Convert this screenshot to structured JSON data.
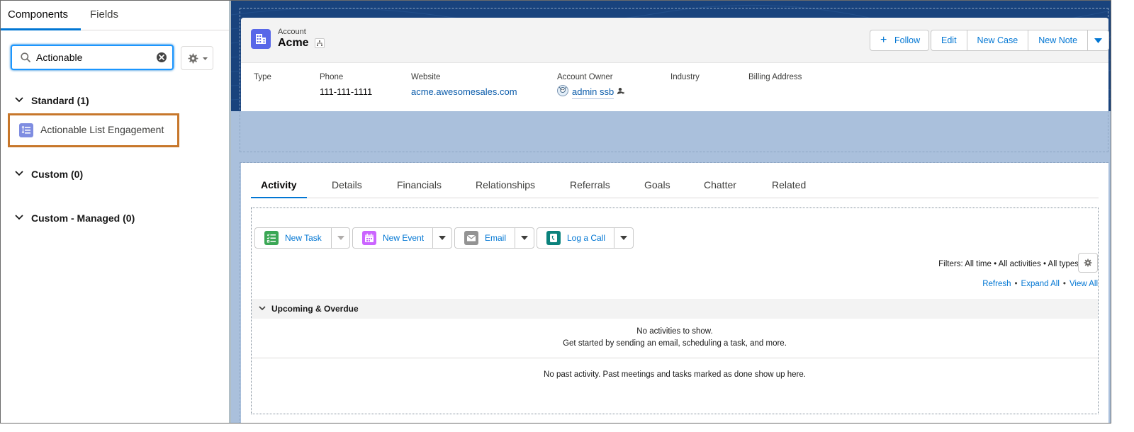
{
  "left_panel": {
    "tabs": [
      {
        "label": "Components",
        "active": true
      },
      {
        "label": "Fields",
        "active": false
      }
    ],
    "search": {
      "value": "Actionable",
      "placeholder": ""
    },
    "sections": [
      {
        "label": "Standard (1)",
        "items": [
          "Actionable List Engagement"
        ]
      },
      {
        "label": "Custom (0)",
        "items": []
      },
      {
        "label": "Custom - Managed (0)",
        "items": []
      }
    ]
  },
  "record": {
    "object_label": "Account",
    "name": "Acme",
    "buttons": {
      "follow": "Follow",
      "edit": "Edit",
      "new_case": "New Case",
      "new_note": "New Note"
    },
    "fields": [
      {
        "label": "Type",
        "value": ""
      },
      {
        "label": "Phone",
        "value": "111-111-1111"
      },
      {
        "label": "Website",
        "value": "acme.awesomesales.com"
      },
      {
        "label": "Account Owner",
        "value": "admin ssb"
      },
      {
        "label": "Industry",
        "value": ""
      },
      {
        "label": "Billing Address",
        "value": ""
      }
    ]
  },
  "activity": {
    "tabs": [
      "Activity",
      "Details",
      "Financials",
      "Relationships",
      "Referrals",
      "Goals",
      "Chatter",
      "Related"
    ],
    "active_tab": "Activity",
    "publishers": [
      {
        "label": "New Task",
        "icon": "task-icon",
        "color": "#3ba755"
      },
      {
        "label": "New Event",
        "icon": "event-icon",
        "color": "#cb65ff"
      },
      {
        "label": "Email",
        "icon": "email-icon",
        "color": "#939393"
      },
      {
        "label": "Log a Call",
        "icon": "call-icon",
        "color": "#0b827c"
      }
    ],
    "filters_text": "Filters: All time • All activities • All types",
    "links": {
      "refresh": "Refresh",
      "expand_all": "Expand All",
      "view_all": "View All"
    },
    "upcoming_label": "Upcoming & Overdue",
    "empty_line1": "No activities to show.",
    "empty_line2": "Get started by sending an email, scheduling a task, and more.",
    "past_empty": "No past activity. Past meetings and tasks marked as done show up here."
  },
  "colors": {
    "brand": "#0176d3",
    "highlight_border": "#c7772b",
    "banner": "#19437d",
    "account_icon": "#5867e8"
  }
}
